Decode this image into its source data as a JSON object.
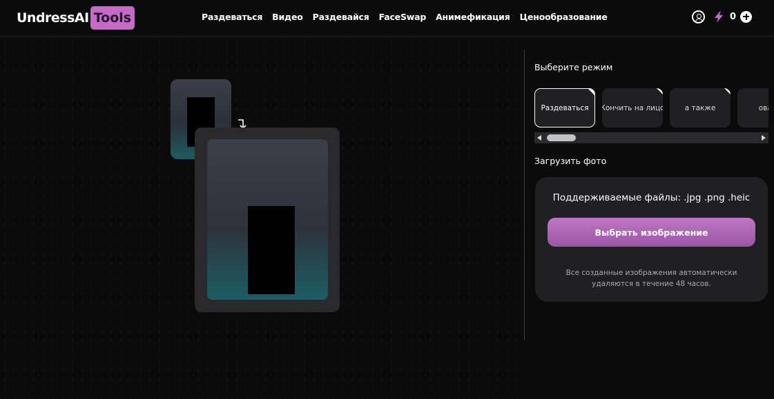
{
  "header": {
    "logo_main": "UndressAI",
    "logo_badge": "Tools",
    "nav": [
      "Раздеваться",
      "Видео",
      "Раздевайся",
      "FaceSwap",
      "Анимефикация",
      "Ценообразование"
    ],
    "credits": "0"
  },
  "modes": {
    "title": "Выберите режим",
    "items": [
      "Раздеваться",
      "Кончить на лицо",
      "а также",
      "ователь"
    ]
  },
  "upload": {
    "title": "Загрузить фото",
    "formats": "Поддерживаемые файлы: .jpg .png .heic",
    "button_label": "Выбрать изображение",
    "note": "Все созданные изображения автоматически удаляются в течение 48 часов."
  },
  "colors": {
    "accent": "#c46bc8",
    "button": "#b46ab8",
    "panel": "#202024"
  }
}
